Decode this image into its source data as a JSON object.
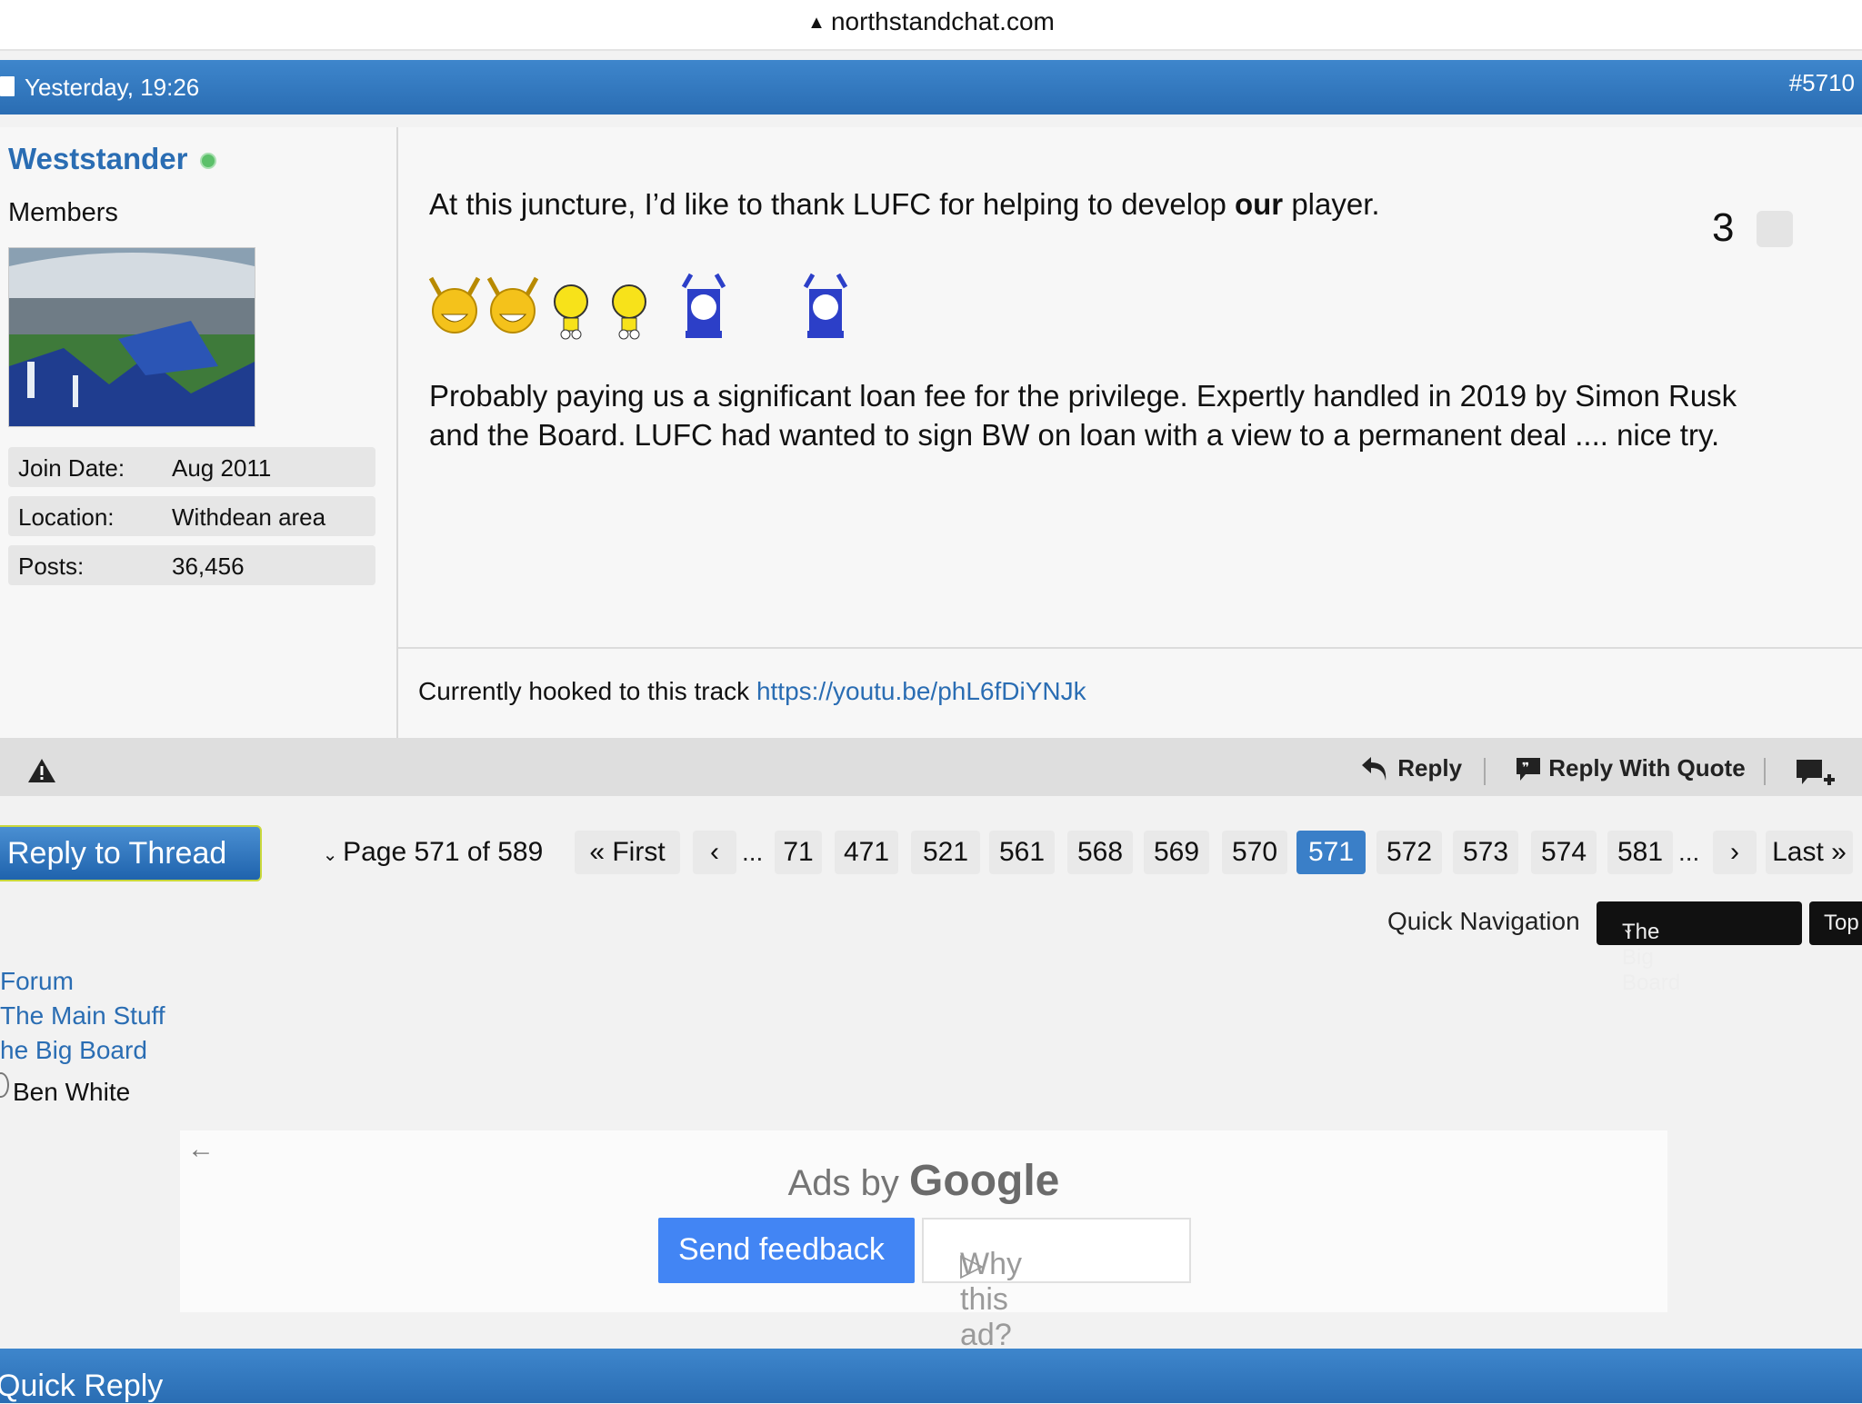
{
  "browser": {
    "url": "northstandchat.com"
  },
  "post": {
    "date": "Yesterday, 19:26",
    "number": "#5710",
    "user": {
      "name": "Weststander",
      "title": "Members",
      "info": [
        {
          "label": "Join Date:",
          "value": "Aug 2011"
        },
        {
          "label": "Location:",
          "value": "Withdean area"
        },
        {
          "label": "Posts:",
          "value": "36,456"
        }
      ]
    },
    "message": {
      "line1_before": "At this juncture, I’d like to thank LUFC for helping to develop ",
      "line1_bold": "our",
      "line1_after": " player.",
      "paragraph": "Probably paying us a significant loan fee for the privilege. Expertly handled in 2019 by Simon Rusk and the Board. LUFC had wanted to sign BW on loan with a view to a permanent deal .... nice try."
    },
    "likes": "3",
    "signature": {
      "text": "Currently hooked to this track ",
      "link": "https://youtu.be/phL6fDiYNJk"
    },
    "footer": {
      "reply": "Reply",
      "reply_quote": "Reply With Quote"
    }
  },
  "pagination": {
    "reply_thread": "Reply to Thread",
    "page_label": "Page 571 of 589",
    "first": "First",
    "last": "Last",
    "pages": [
      "71",
      "471",
      "521",
      "561",
      "568",
      "569",
      "570",
      "571",
      "572",
      "573",
      "574",
      "581"
    ],
    "current": "571",
    "dots": "..."
  },
  "quick_nav": {
    "label": "Quick Navigation",
    "selected": "The Big Board",
    "top": "Top"
  },
  "breadcrumb": {
    "items": [
      "Forum",
      "The Main Stuff",
      "he Big Board"
    ],
    "current": "Ben White"
  },
  "ad": {
    "ads_by": "Ads by ",
    "google": "Google",
    "send_feedback": "Send feedback",
    "why_ad": "Why this ad?"
  },
  "quick_reply": {
    "title": "Quick Reply"
  },
  "colors": {
    "accent": "#2a6db3",
    "header": "#3e86cc",
    "current_page": "#3a7fc8",
    "google_blue": "#4285f4"
  }
}
